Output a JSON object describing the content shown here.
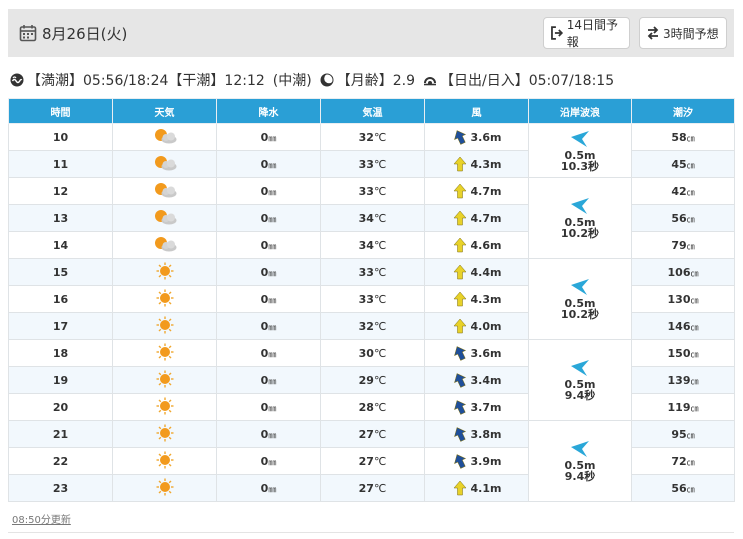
{
  "header": {
    "date": "8月26日(火)",
    "btn_14day": "14日間予報",
    "btn_3hour": "3時間予想"
  },
  "tide": {
    "high_label": "【満潮】05:56/18:24",
    "low_label": "【干潮】12:12",
    "tide_type": "(中潮)",
    "moon_label": "【月齢】2.9",
    "sun_label": "【日出/日入】05:07/18:15"
  },
  "columns": [
    "時間",
    "天気",
    "降水",
    "気温",
    "風",
    "沿岸波浪",
    "潮汐"
  ],
  "rows": [
    {
      "hour": "10",
      "weather": "cloudy-sun",
      "rain": "0",
      "temp": "32",
      "wind_speed": "3.6m",
      "wind_color": "blue",
      "tide": "58"
    },
    {
      "hour": "11",
      "weather": "cloudy-sun",
      "rain": "0",
      "temp": "33",
      "wind_speed": "4.3m",
      "wind_color": "yellow",
      "tide": "45"
    },
    {
      "hour": "12",
      "weather": "cloudy-sun",
      "rain": "0",
      "temp": "33",
      "wind_speed": "4.7m",
      "wind_color": "yellow",
      "tide": "42"
    },
    {
      "hour": "13",
      "weather": "cloudy-sun",
      "rain": "0",
      "temp": "34",
      "wind_speed": "4.7m",
      "wind_color": "yellow",
      "tide": "56"
    },
    {
      "hour": "14",
      "weather": "cloudy-sun",
      "rain": "0",
      "temp": "34",
      "wind_speed": "4.6m",
      "wind_color": "yellow",
      "tide": "79"
    },
    {
      "hour": "15",
      "weather": "sunny",
      "rain": "0",
      "temp": "33",
      "wind_speed": "4.4m",
      "wind_color": "yellow",
      "tide": "106"
    },
    {
      "hour": "16",
      "weather": "sunny",
      "rain": "0",
      "temp": "33",
      "wind_speed": "4.3m",
      "wind_color": "yellow",
      "tide": "130"
    },
    {
      "hour": "17",
      "weather": "sunny",
      "rain": "0",
      "temp": "32",
      "wind_speed": "4.0m",
      "wind_color": "yellow",
      "tide": "146"
    },
    {
      "hour": "18",
      "weather": "sunny",
      "rain": "0",
      "temp": "30",
      "wind_speed": "3.6m",
      "wind_color": "blue",
      "tide": "150"
    },
    {
      "hour": "19",
      "weather": "sunny",
      "rain": "0",
      "temp": "29",
      "wind_speed": "3.4m",
      "wind_color": "blue",
      "tide": "139"
    },
    {
      "hour": "20",
      "weather": "sunny",
      "rain": "0",
      "temp": "28",
      "wind_speed": "3.7m",
      "wind_color": "blue",
      "tide": "119"
    },
    {
      "hour": "21",
      "weather": "sunny",
      "rain": "0",
      "temp": "27",
      "wind_speed": "3.8m",
      "wind_color": "blue",
      "tide": "95"
    },
    {
      "hour": "22",
      "weather": "sunny",
      "rain": "0",
      "temp": "27",
      "wind_speed": "3.9m",
      "wind_color": "blue",
      "tide": "72"
    },
    {
      "hour": "23",
      "weather": "sunny",
      "rain": "0",
      "temp": "27",
      "wind_speed": "4.1m",
      "wind_color": "yellow",
      "tide": "56"
    }
  ],
  "waves": [
    {
      "height": "0.5m",
      "period": "10.3秒",
      "rows": 2
    },
    {
      "height": "0.5m",
      "period": "10.2秒",
      "rows": 3
    },
    {
      "height": "0.5m",
      "period": "10.2秒",
      "rows": 3
    },
    {
      "height": "0.5m",
      "period": "9.4秒",
      "rows": 3
    },
    {
      "height": "0.5m",
      "period": "9.4秒",
      "rows": 3
    }
  ],
  "units": {
    "rain": "㎜",
    "temp": "℃",
    "tide": "㎝"
  },
  "updated": "08:50分更新",
  "colors": {
    "header_bg": "#2a9fd6",
    "wind_blue": "#1f4f9a",
    "wind_yellow": "#e8d22a",
    "wave_arrow": "#2aa7d8",
    "sun": "#f29a1d"
  }
}
